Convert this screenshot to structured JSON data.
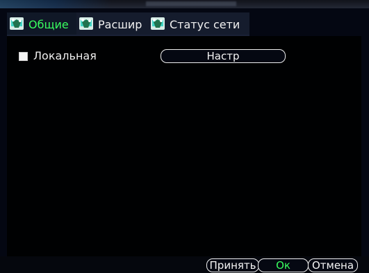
{
  "tabs": [
    {
      "label": "Общие",
      "icon": "network-icon",
      "active": true
    },
    {
      "label": "Расшир",
      "icon": "network-icon",
      "active": false
    },
    {
      "label": "Статус сети",
      "icon": "network-icon",
      "active": false
    }
  ],
  "general": {
    "local_label": "Локальная",
    "local_checked": false,
    "settings_button_label": "Настр"
  },
  "footer": {
    "accept_label": "Принять",
    "ok_label": "Ок",
    "cancel_label": "Отмена"
  },
  "colors": {
    "active_tab": "#39ff5f",
    "text": "#f1f1f1",
    "background": "#000102",
    "tab_background": "#151c2d"
  }
}
